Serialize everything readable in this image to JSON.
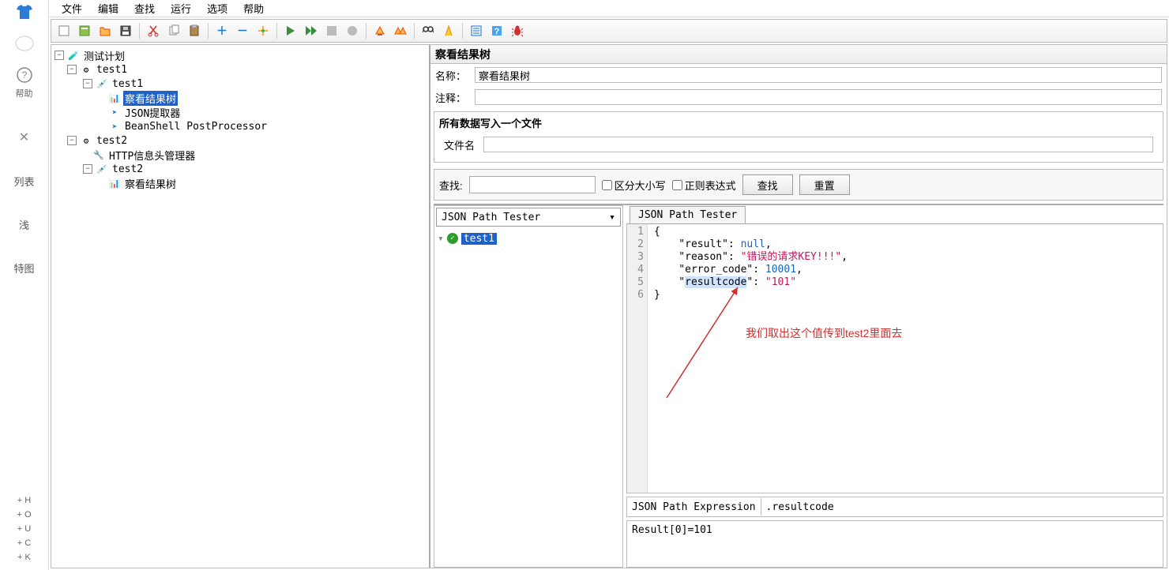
{
  "leftRail": {
    "helpLabel": "帮助",
    "listLabel": "列表",
    "ganttLabel": "特图",
    "bottom": [
      "+ H",
      "+ O",
      "+ U",
      "+ C",
      "+ K"
    ]
  },
  "menu": [
    "文件",
    "编辑",
    "查找",
    "运行",
    "选项",
    "帮助"
  ],
  "tree": {
    "root": "测试计划",
    "test1_group": "test1",
    "test1_sampler": "test1",
    "result_tree_1": "察看结果树",
    "json_extractor": "JSON提取器",
    "beanshell_pp": "BeanShell PostProcessor",
    "test2_group": "test2",
    "http_header": "HTTP信息头管理器",
    "test2_sampler": "test2",
    "result_tree_2": "察看结果树"
  },
  "rightPanel": {
    "title": "察看结果树",
    "nameLabel": "名称：",
    "nameValue": "察看结果树",
    "commentLabel": "注释：",
    "commentValue": "",
    "fileSection": "所有数据写入一个文件",
    "filenameLabel": "文件名",
    "filenameValue": ""
  },
  "search": {
    "label": "查找:",
    "value": "",
    "caseSensitive": "区分大小写",
    "regex": "正则表达式",
    "searchBtn": "查找",
    "resetBtn": "重置"
  },
  "dropdown": "JSON Path Tester",
  "resultItem": "test1",
  "tabLabel": "JSON Path Tester",
  "codeLines": [
    "1",
    "2",
    "3",
    "4",
    "5",
    "6"
  ],
  "json": {
    "l1": "{",
    "l2a": "    \"result\": ",
    "l2b": "null",
    "l2c": ",",
    "l3a": "    \"reason\": ",
    "l3b": "\"错误的请求KEY!!!\"",
    "l3c": ",",
    "l4a": "    \"error_code\": ",
    "l4b": "10001",
    "l4c": ",",
    "l5a": "    \"",
    "l5h": "resultcode",
    "l5b": "\": ",
    "l5c": "\"101\"",
    "l6": "}"
  },
  "annotation": "我们取出这个值传到test2里面去",
  "expr": {
    "label": "JSON Path Expression",
    "value": ".resultcode"
  },
  "resultText": "Result[0]=101"
}
